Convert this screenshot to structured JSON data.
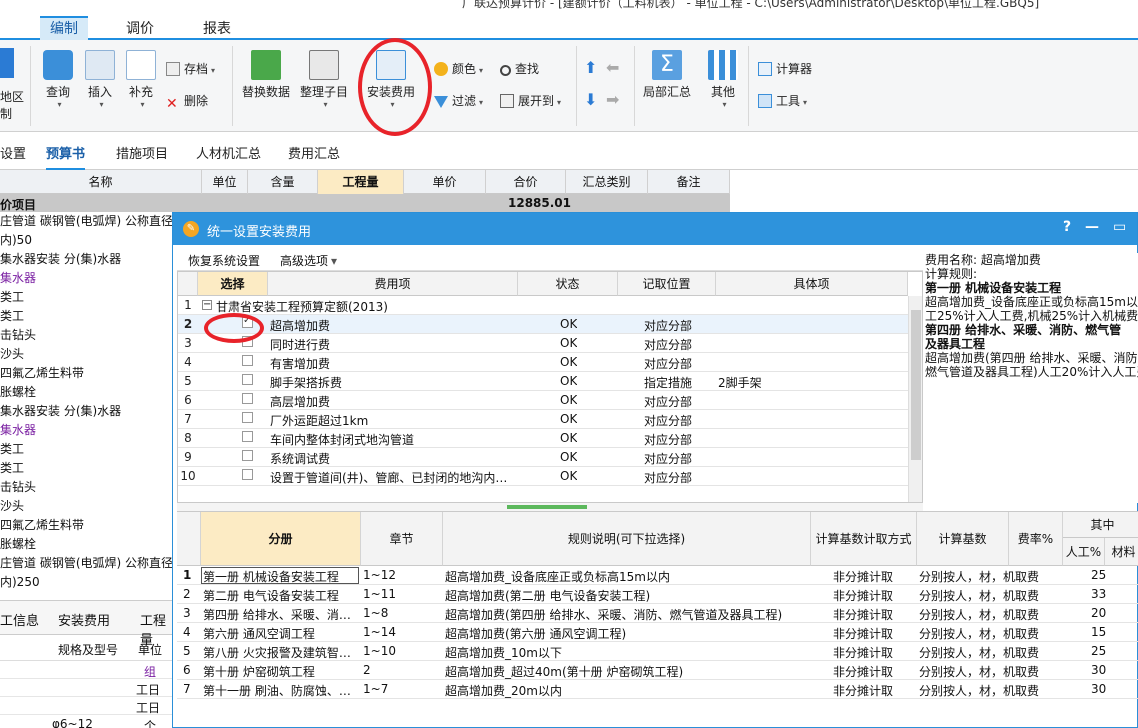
{
  "window_title": "广联达预算计价 - [建额计价（工料机表） - 单位工程 - C:\\Users\\Administrator\\Desktop\\单位工程.GBQ5]",
  "menu_tabs": [
    "编制",
    "调价",
    "报表"
  ],
  "ribbon": {
    "region": "地区\n制",
    "query": "查询",
    "insert": "插入",
    "supplement": "补充",
    "save": "存档",
    "delete": "删除",
    "replace": "替换数据",
    "organize": "整理子目",
    "install_fee": "安装费用",
    "color": "颜色",
    "filter": "过滤",
    "find": "查找",
    "expand": "展开到",
    "local_summary": "局部汇总",
    "other": "其他",
    "calculator": "计算器",
    "tools": "工具"
  },
  "sub_tabs": [
    "设置",
    "预算书",
    "措施项目",
    "人材机汇总",
    "费用汇总"
  ],
  "grid_headers": [
    "名称",
    "单位",
    "含量",
    "工程量",
    "单价",
    "合价",
    "汇总类别",
    "备注"
  ],
  "sum_row": {
    "label": "价项目",
    "total": "12885.01"
  },
  "left_tree": [
    "庄管道 碳钢管(电弧焊) 公称直径",
    "内)50",
    "集水器安装 分(集)水器",
    "集水器",
    "类工",
    "类工",
    "击钻头",
    "沙头",
    "四氟乙烯生料带",
    "胀螺栓",
    "集水器安装 分(集)水器",
    "集水器",
    "类工",
    "类工",
    "击钻头",
    "沙头",
    "四氟乙烯生料带",
    "胀螺栓",
    "庄管道 碳钢管(电弧焊) 公称直径",
    "内)250"
  ],
  "bottom_left": {
    "tabs": [
      "工信息",
      "安装费用",
      "工程量"
    ],
    "header": [
      "规格及型号",
      "单位"
    ],
    "rows": [
      {
        "spec": "",
        "unit": "组"
      },
      {
        "spec": "",
        "unit": "工日"
      },
      {
        "spec": "",
        "unit": "工日"
      },
      {
        "spec": "φ6~12",
        "unit": "个"
      }
    ]
  },
  "dialog": {
    "title": "统一设置安装费用",
    "help": "?",
    "minimize": "—",
    "restore": "▭",
    "restore_btn": "恢复系统设置",
    "advanced": "高级选项",
    "upper_headers": [
      "选择",
      "费用项",
      "状态",
      "记取位置",
      "具体项"
    ],
    "group_row": {
      "num": "1",
      "text": "甘肃省安装工程预算定额(2013)"
    },
    "upper_rows": [
      {
        "num": "2",
        "name": "超高增加费",
        "state": "OK",
        "pos": "对应分部",
        "detail": ""
      },
      {
        "num": "3",
        "name": "同时进行费",
        "state": "OK",
        "pos": "对应分部",
        "detail": ""
      },
      {
        "num": "4",
        "name": "有害增加费",
        "state": "OK",
        "pos": "对应分部",
        "detail": ""
      },
      {
        "num": "5",
        "name": "脚手架搭拆费",
        "state": "OK",
        "pos": "指定措施",
        "detail": "2脚手架"
      },
      {
        "num": "6",
        "name": "高层增加费",
        "state": "OK",
        "pos": "对应分部",
        "detail": ""
      },
      {
        "num": "7",
        "name": "厂外运距超过1km",
        "state": "OK",
        "pos": "对应分部",
        "detail": ""
      },
      {
        "num": "8",
        "name": "车间内整体封闭式地沟管道",
        "state": "OK",
        "pos": "对应分部",
        "detail": ""
      },
      {
        "num": "9",
        "name": "系统调试费",
        "state": "OK",
        "pos": "对应分部",
        "detail": ""
      },
      {
        "num": "10",
        "name": "设置于管道间(井)、管廊、已封闭的地沟内…",
        "state": "OK",
        "pos": "对应分部",
        "detail": ""
      }
    ],
    "right_panel": [
      "费用名称: 超高增加费",
      "计算规则:",
      "第一册 机械设备安装工程",
      "超高增加费_设备底座正或负标高15m以内",
      "工25%计入人工费,机械25%计入机械费",
      "第四册 给排水、采暖、消防、燃气管",
      "及器具工程",
      "超高增加费(第四册 给排水、采暖、消防",
      "燃气管道及器具工程)人工20%计入人工费"
    ],
    "lower_headers": [
      "分册",
      "章节",
      "规则说明(可下拉选择)",
      "计算基数计取方式",
      "计算基数",
      "费率%",
      "其中",
      "人工%",
      "材料"
    ],
    "lower_rows": [
      {
        "num": "1",
        "book": "第一册 机械设备安装工程",
        "ch": "1~12",
        "rule": "超高增加费_设备底座正或负标高15m以内",
        "mode": "非分摊计取",
        "base": "分别按人，材，机取费",
        "rate": "",
        "labor": "25"
      },
      {
        "num": "2",
        "book": "第二册 电气设备安装工程",
        "ch": "1~11",
        "rule": "超高增加费(第二册 电气设备安装工程)",
        "mode": "非分摊计取",
        "base": "分别按人，材，机取费",
        "rate": "",
        "labor": "33"
      },
      {
        "num": "3",
        "book": "第四册 给排水、采暖、消…",
        "ch": "1~8",
        "rule": "超高增加费(第四册 给排水、采暖、消防、燃气管道及器具工程)",
        "mode": "非分摊计取",
        "base": "分别按人，材，机取费",
        "rate": "",
        "labor": "20"
      },
      {
        "num": "4",
        "book": "第六册 通风空调工程",
        "ch": "1~14",
        "rule": "超高增加费(第六册 通风空调工程)",
        "mode": "非分摊计取",
        "base": "分别按人，材，机取费",
        "rate": "",
        "labor": "15"
      },
      {
        "num": "5",
        "book": "第八册 火灾报警及建筑智…",
        "ch": "1~10",
        "rule": "超高增加费_10m以下",
        "mode": "非分摊计取",
        "base": "分别按人，材，机取费",
        "rate": "",
        "labor": "25"
      },
      {
        "num": "6",
        "book": "第十册 炉窑砌筑工程",
        "ch": "2",
        "rule": "超高增加费_超过40m(第十册 炉窑砌筑工程)",
        "mode": "非分摊计取",
        "base": "分别按人，材，机取费",
        "rate": "",
        "labor": "30"
      },
      {
        "num": "7",
        "book": "第十一册 刷油、防腐蚀、…",
        "ch": "1~7",
        "rule": "超高增加费_20m以内",
        "mode": "非分摊计取",
        "base": "分别按人，材，机取费",
        "rate": "",
        "labor": "30"
      }
    ]
  }
}
